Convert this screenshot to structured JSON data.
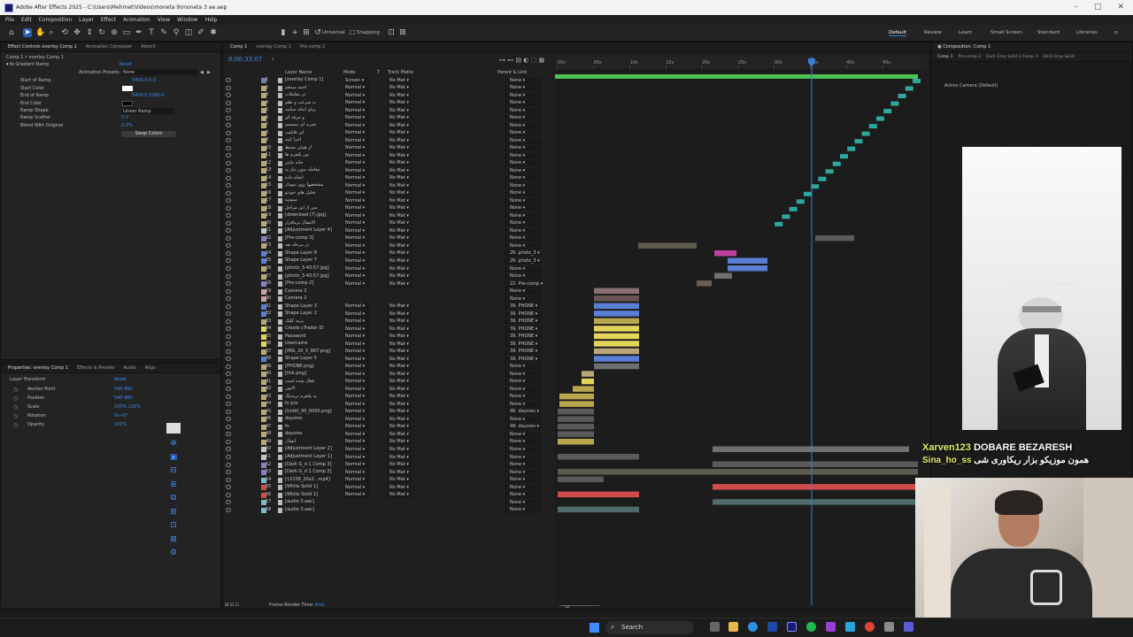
{
  "app": {
    "title": "Adobe After Effects 2025 - C:\\Users\\Mehmet\\Videos\\moneta 9\\moneta 3 ae.aep",
    "menu": [
      "File",
      "Edit",
      "Composition",
      "Layer",
      "Effect",
      "Animation",
      "View",
      "Window",
      "Help"
    ],
    "toolbar": {
      "universal": "Universal",
      "snapping": "Snapping"
    },
    "workspaces": [
      "Default",
      "Review",
      "Learn",
      "Small Screen",
      "Standard",
      "Libraries"
    ]
  },
  "effect_controls": {
    "tabs": [
      "Effect Controls overlay Comp 1",
      "Animation Composer",
      "AtomX"
    ],
    "header": "Comp 1 • overlay Comp 1",
    "effect_name": "Gradient Ramp",
    "reset": "Reset",
    "animation_presets": "Animation Presets:",
    "presets_value": "None",
    "props": [
      {
        "name": "Start of Ramp",
        "value": "5400.0,0.0"
      },
      {
        "name": "Start Color",
        "value": ""
      },
      {
        "name": "End of Ramp",
        "value": "5400.0,1080.0"
      },
      {
        "name": "End Color",
        "value": ""
      },
      {
        "name": "Ramp Shape",
        "value": "Linear Ramp"
      },
      {
        "name": "Ramp Scatter",
        "value": "0.0"
      },
      {
        "name": "Blend With Original",
        "value": "0.0%"
      }
    ],
    "swap_button": "Swap Colors"
  },
  "properties": {
    "tabs": [
      "Properties: overlay Comp 1",
      "Effects & Presets",
      "Audio",
      "Align"
    ],
    "section": "Layer Transform",
    "reset": "Reset",
    "items": [
      {
        "name": "Anchor Point",
        "value": "540   960"
      },
      {
        "name": "Position",
        "value": "540   960"
      },
      {
        "name": "Scale",
        "value": "100%   100%"
      },
      {
        "name": "Rotation",
        "value": "0x+0°"
      },
      {
        "name": "Opacity",
        "value": "100%"
      }
    ]
  },
  "timeline": {
    "tabs": [
      "Comp 1",
      "overlay Comp 1",
      "Pre-comp 2"
    ],
    "timecode": "0;00;33;07",
    "columns": [
      "Layer Name",
      "Mode",
      "T",
      "Track Matte",
      "Parent & Link"
    ],
    "ruler": [
      "00s",
      "05s",
      "10s",
      "15s",
      "20s",
      "25s",
      "30s",
      "35s",
      "40s",
      "45s"
    ],
    "footer": "Frame Render Time:",
    "footer_value": "6ms",
    "layers": [
      {
        "n": "1",
        "name": "[overlay Comp 1]",
        "mode": "Screen",
        "parent": "None",
        "color": "#6f7fa8"
      },
      {
        "n": "2",
        "name": "احمد میدهم",
        "mode": "Normal",
        "parent": "None",
        "color": "#b9a777"
      },
      {
        "n": "3",
        "name": "در معاملات",
        "mode": "Normal",
        "parent": "None",
        "color": "#b9a777"
      },
      {
        "n": "4",
        "name": "به سرعت و نظم",
        "mode": "Normal",
        "parent": "None",
        "color": "#b9a777"
      },
      {
        "n": "5",
        "name": "برای اینکه میکنید",
        "mode": "Normal",
        "parent": "None",
        "color": "#b9a777"
      },
      {
        "n": "6",
        "name": "و حرفه ای",
        "mode": "Normal",
        "parent": "None",
        "color": "#b9a777"
      },
      {
        "n": "7",
        "name": "تجربه ای منسجم",
        "mode": "Normal",
        "parent": "None",
        "color": "#b9a777"
      },
      {
        "n": "8",
        "name": "این قابلیت",
        "mode": "Normal",
        "parent": "None",
        "color": "#b9a777"
      },
      {
        "n": "9",
        "name": "اجرا کنید",
        "mode": "Normal",
        "parent": "None",
        "color": "#b9a777"
      },
      {
        "n": "10",
        "name": "از همان محیط",
        "mode": "Normal",
        "parent": "None",
        "color": "#b9a777"
      },
      {
        "n": "11",
        "name": "بین پلتفرم ها",
        "mode": "Normal",
        "parent": "None",
        "color": "#b9a777"
      },
      {
        "n": "12",
        "name": "جابه جایی",
        "mode": "Normal",
        "parent": "None",
        "color": "#b9a777"
      },
      {
        "n": "13",
        "name": "معامله بدون نیاز به",
        "mode": "Normal",
        "parent": "None",
        "color": "#b9a777"
      },
      {
        "n": "14",
        "name": "انجام داده",
        "mode": "Normal",
        "parent": "None",
        "color": "#b9a777"
      },
      {
        "n": "15",
        "name": "مشخصها روی نمودار",
        "mode": "Normal",
        "parent": "None",
        "color": "#b9a777"
      },
      {
        "n": "16",
        "name": "تحلیل های خودتو",
        "mode": "Normal",
        "parent": "None",
        "color": "#b9a777"
      },
      {
        "n": "17",
        "name": "میتونید",
        "mode": "Normal",
        "parent": "None",
        "color": "#b9a777"
      },
      {
        "n": "18",
        "name": "پس از این مراحل",
        "mode": "Normal",
        "parent": "None",
        "color": "#b9a777"
      },
      {
        "n": "19",
        "name": "[download (7).jpg]",
        "mode": "Normal",
        "parent": "None",
        "color": "#b9a777"
      },
      {
        "n": "20",
        "name": "الاتصال نرمافزار",
        "mode": "Normal",
        "parent": "None",
        "color": "#b9a777"
      },
      {
        "n": "21",
        "name": "[Adjustment Layer 4]",
        "mode": "Normal",
        "parent": "None",
        "color": "#c5c5c5"
      },
      {
        "n": "22",
        "name": "[Pre-comp 3]",
        "mode": "Normal",
        "parent": "None",
        "color": "#8e7cc3"
      },
      {
        "n": "23",
        "name": "در مرحله بعد",
        "mode": "Normal",
        "parent": "None",
        "color": "#b9a777"
      },
      {
        "n": "24",
        "name": "Shape Layer 8",
        "mode": "Normal",
        "parent": "26. photo_3",
        "color": "#5a7fd6"
      },
      {
        "n": "25",
        "name": "Shape Layer 7",
        "mode": "Normal",
        "parent": "26. photo_3",
        "color": "#5a7fd6"
      },
      {
        "n": "26",
        "name": "[photo_3-43-57.jpg]",
        "mode": "Normal",
        "parent": "None",
        "color": "#b9a777"
      },
      {
        "n": "27",
        "name": "[photo_3-43-57.jpg]",
        "mode": "Normal",
        "parent": "None",
        "color": "#b9a777"
      },
      {
        "n": "28",
        "name": "[Pre-comp 2]",
        "mode": "Normal",
        "parent": "22. Pre-comp",
        "color": "#8e7cc3"
      },
      {
        "n": "29",
        "name": "Camera 3",
        "mode": "",
        "parent": "None",
        "color": "#c9a0a0"
      },
      {
        "n": "30",
        "name": "Camera 2",
        "mode": "",
        "parent": "None",
        "color": "#c9a0a0"
      },
      {
        "n": "31",
        "name": "Shape Layer 3",
        "mode": "Normal",
        "parent": "39. PHONE",
        "color": "#5a7fd6"
      },
      {
        "n": "32",
        "name": "Shape Layer 2",
        "mode": "Normal",
        "parent": "39. PHONE",
        "color": "#5a7fd6"
      },
      {
        "n": "33",
        "name": "بزنید کلیک",
        "mode": "Normal",
        "parent": "39. PHONE",
        "color": "#b9a777"
      },
      {
        "n": "34",
        "name": "Create cTrader ID",
        "mode": "Normal",
        "parent": "39. PHONE",
        "color": "#e3d45a"
      },
      {
        "n": "35",
        "name": "Password",
        "mode": "Normal",
        "parent": "39. PHONE",
        "color": "#e3d45a"
      },
      {
        "n": "36",
        "name": "Username",
        "mode": "Normal",
        "parent": "39. PHONE",
        "color": "#e3d45a"
      },
      {
        "n": "37",
        "name": "[IMG_20_5_967.png]",
        "mode": "Normal",
        "parent": "39. PHONE",
        "color": "#b9a777"
      },
      {
        "n": "38",
        "name": "Shape Layer 5",
        "mode": "Normal",
        "parent": "39. PHONE",
        "color": "#5a7fd6"
      },
      {
        "n": "39",
        "name": "[PHONE.png]",
        "mode": "Normal",
        "parent": "None",
        "color": "#b9a777"
      },
      {
        "n": "40",
        "name": "[link.png]",
        "mode": "Normal",
        "parent": "None",
        "color": "#b9a777"
      },
      {
        "n": "41",
        "name": "فعال شده است",
        "mode": "Normal",
        "parent": "None",
        "color": "#b9a777"
      },
      {
        "n": "42",
        "name": "اکنون",
        "mode": "Normal",
        "parent": "None",
        "color": "#b9a777"
      },
      {
        "n": "43",
        "name": "به پلتفرم تریدینگ",
        "mode": "Normal",
        "parent": "None",
        "color": "#b9a777"
      },
      {
        "n": "44",
        "name": "fx pro",
        "mode": "Normal",
        "parent": "None",
        "color": "#b9a777"
      },
      {
        "n": "45",
        "name": "[Untitl_00_0000.png]",
        "mode": "Normal",
        "parent": "46. daysres",
        "color": "#b9a777"
      },
      {
        "n": "46",
        "name": "daysres",
        "mode": "Normal",
        "parent": "None",
        "color": "#b9a777"
      },
      {
        "n": "47",
        "name": "fx",
        "mode": "Normal",
        "parent": "48. daysres",
        "color": "#b9a777"
      },
      {
        "n": "48",
        "name": "daysres",
        "mode": "Normal",
        "parent": "None",
        "color": "#b9a777"
      },
      {
        "n": "49",
        "name": "اتصال",
        "mode": "Normal",
        "parent": "None",
        "color": "#b9a777"
      },
      {
        "n": "50",
        "name": "[Adjustment Layer 2]",
        "mode": "Normal",
        "parent": "None",
        "color": "#c5c5c5"
      },
      {
        "n": "51",
        "name": "[Adjustment Layer 1]",
        "mode": "Normal",
        "parent": "None",
        "color": "#c5c5c5"
      },
      {
        "n": "52",
        "name": "[Dark G_d 1 Comp 3]",
        "mode": "Normal",
        "parent": "None",
        "color": "#8e7cc3"
      },
      {
        "n": "53",
        "name": "[Dark G_d 1 Comp 2]",
        "mode": "Normal",
        "parent": "None",
        "color": "#8e7cc3"
      },
      {
        "n": "54",
        "name": "[12158_20x2...mp4]",
        "mode": "Normal",
        "parent": "None",
        "color": "#7fb6c9"
      },
      {
        "n": "55",
        "name": "[White Solid 1]",
        "mode": "Normal",
        "parent": "None",
        "color": "#d14b4b"
      },
      {
        "n": "56",
        "name": "[White Solid 1]",
        "mode": "Normal",
        "parent": "None",
        "color": "#d14b4b"
      },
      {
        "n": "57",
        "name": "[audio 3.aac]",
        "mode": "",
        "parent": "None",
        "color": "#7fb6c9"
      },
      {
        "n": "58",
        "name": "[audio 3.aac]",
        "mode": "",
        "parent": "None",
        "color": "#7fb6c9"
      }
    ],
    "trackmatte": "No Mat"
  },
  "comp_viewer": {
    "tabs": [
      "Comp 1",
      "Pre-comp 2",
      "Dark Gray Solid 1 Comp 3",
      "Dark Gray Solid"
    ],
    "camera": "Active Camera (Default)",
    "overlay_text": "معامله را بدون نیاز به"
  },
  "chat": {
    "user1": "Xarven123",
    "msg1": "DOBARE BEZARESH",
    "user2": "Sina_ho_ss",
    "msg2": "همون موزیکو بزار ریکاوری شی"
  },
  "taskbar": {
    "search": "Search"
  },
  "colors": {
    "accent": "#2a5db0",
    "playhead": "#3d7fd6",
    "keyframe_green": "#2ea89a",
    "time_bar": "#4cc255"
  }
}
